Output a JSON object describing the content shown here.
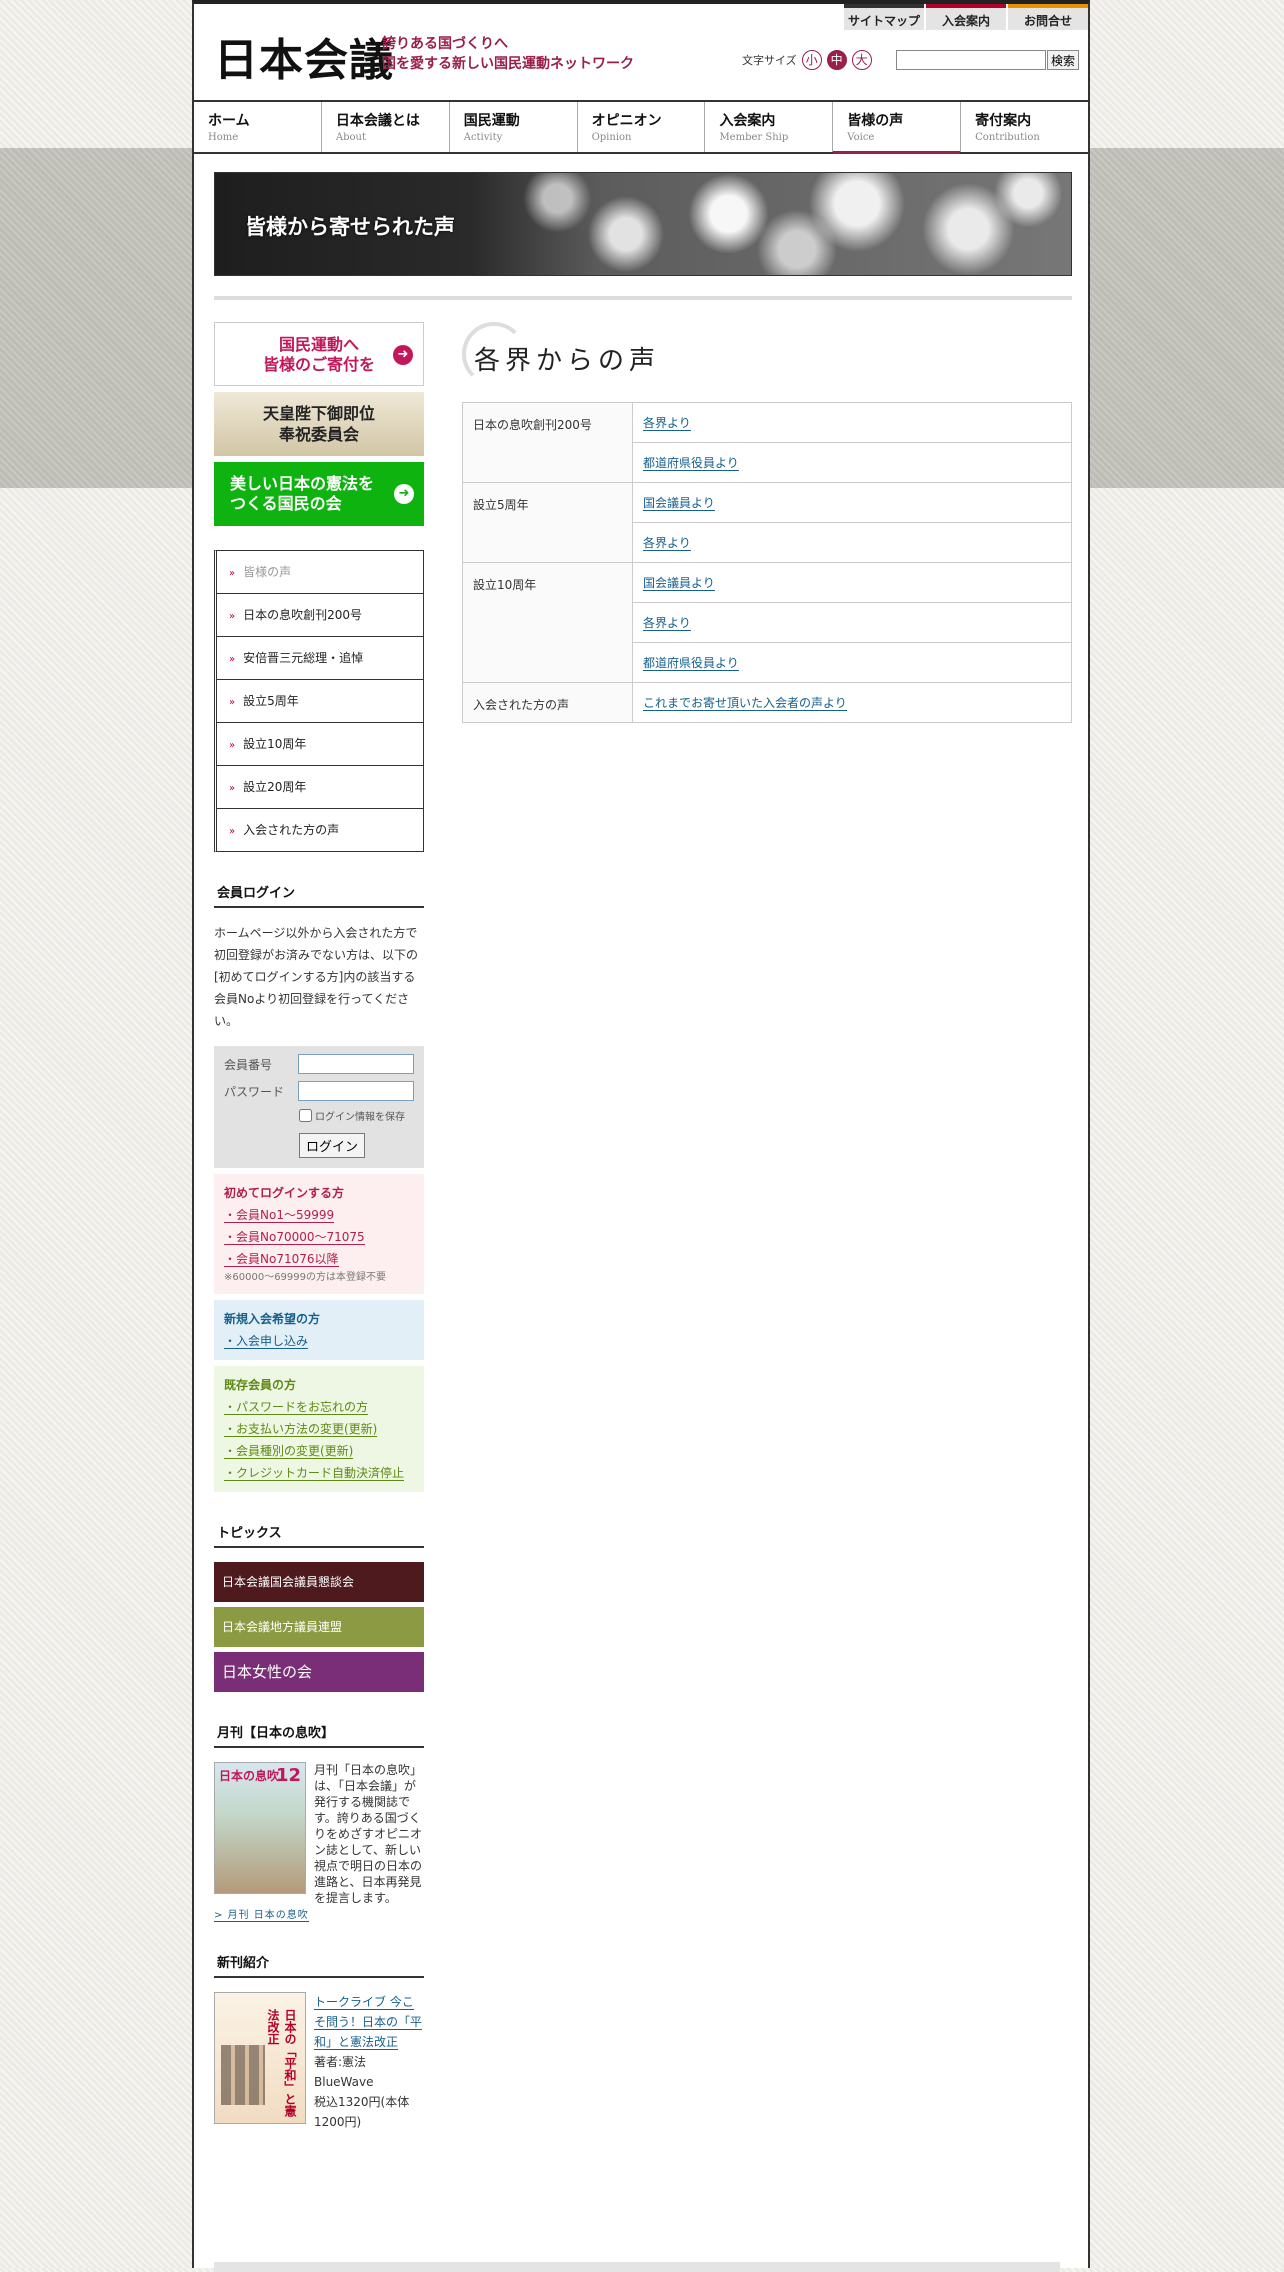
{
  "header": {
    "logo": "日本会議",
    "tagline_1": "誇りある国づくりへ",
    "tagline_2": "国を愛する新しい国民運動ネットワーク",
    "toplinks": [
      "サイトマップ",
      "入会案内",
      "お問合せ"
    ],
    "fontsize_label": "文字サイズ",
    "fontsize_options": [
      "小",
      "中",
      "大"
    ],
    "search_button": "検索",
    "search_value": ""
  },
  "nav": [
    {
      "jp": "ホーム",
      "en": "Home"
    },
    {
      "jp": "日本会議とは",
      "en": "About"
    },
    {
      "jp": "国民運動",
      "en": "Activity"
    },
    {
      "jp": "オピニオン",
      "en": "Opinion"
    },
    {
      "jp": "入会案内",
      "en": "Member Ship"
    },
    {
      "jp": "皆様の声",
      "en": "Voice"
    },
    {
      "jp": "寄付案内",
      "en": "Contribution"
    }
  ],
  "banner": {
    "text": "皆様から寄せられた声"
  },
  "promos": {
    "donate_1": "国民運動へ",
    "donate_2": "皆様のご寄付を",
    "emperor_1": "天皇陛下御即位",
    "emperor_2": "奉祝委員会",
    "constitution_1": "美しい日本の憲法を",
    "constitution_2": "つくる国民の会"
  },
  "submenu": [
    "皆様の声",
    "日本の息吹創刊200号",
    "安倍晋三元総理・追悼",
    "設立5周年",
    "設立10周年",
    "設立20周年",
    "入会された方の声"
  ],
  "login": {
    "title": "会員ログイン",
    "description": "ホームページ以外から入会された方で初回登録がお済みでない方は、以下の[初めてログインする方]内の該当する会員Noより初回登録を行ってください。",
    "member_no_label": "会員番号",
    "password_label": "パスワード",
    "member_no_value": "",
    "password_value": "",
    "remember_label": "ログイン情報を保存",
    "button": "ログイン"
  },
  "first_login": {
    "title": "初めてログインする方",
    "links": [
      "・会員No1～59999",
      "・会員No70000～71075",
      "・会員No71076以降"
    ],
    "note": "※60000～69999の方は本登録不要"
  },
  "new_member": {
    "title": "新規入会希望の方",
    "links": [
      "・入会申し込み"
    ]
  },
  "existing_member": {
    "title": "既存会員の方",
    "links": [
      "・パスワードをお忘れの方",
      "・お支払い方法の変更(更新)",
      "・会員種別の変更(更新)",
      "・クレジットカード自動決済停止"
    ]
  },
  "topics": {
    "title": "トピックス",
    "items": [
      "日本会議国会議員懇談会",
      "日本会議地方議員連盟",
      "日本女性の会"
    ]
  },
  "magazine": {
    "title": "月刊【日本の息吹】",
    "cover_title": "日本の息吹",
    "cover_number": "12",
    "description": "月刊「日本の息吹」は、「日本会議」が発行する機関誌です。誇りある国づくりをめざすオピニオン誌として、新しい視点で明日の日本の進路と、日本再発見を提言します。",
    "link": "> 月刊 日本の息吹"
  },
  "new_books": {
    "title": "新刊紹介",
    "cover_title": "日本の「平和」と憲法改正",
    "book_title": "トークライブ 今こそ問う！日本の「平和」と憲法改正",
    "author": "著者:憲法BlueWave",
    "price": "税込1320円(本体1200円)"
  },
  "main": {
    "title": "各界からの声",
    "rows": [
      {
        "category": "日本の息吹創刊200号",
        "links": [
          "各界より",
          "都道府県役員より"
        ]
      },
      {
        "category": "設立5周年",
        "links": [
          "国会議員より",
          "各界より"
        ]
      },
      {
        "category": "設立10周年",
        "links": [
          "国会議員より",
          "各界より",
          "都道府県役員より"
        ]
      },
      {
        "category": "入会された方の声",
        "links": [
          "これまでお寄せ頂いた入会者の声より"
        ]
      }
    ]
  }
}
